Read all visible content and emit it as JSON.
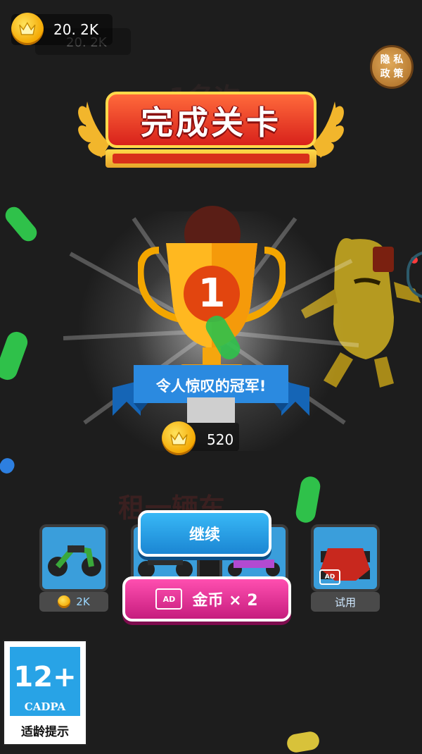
{
  "hud": {
    "coins": "20. 2K",
    "coins_ghost": "20. 2K",
    "privacy_label_1": "隐 私",
    "privacy_label_2": "政 策"
  },
  "result": {
    "title": "完成关卡",
    "rank": "1",
    "ribbon_text": "令人惊叹的冠军!",
    "reward": "520"
  },
  "background_text": {
    "top": "1名次",
    "mid": "租一辆车"
  },
  "vehicles": [
    {
      "name": "motorbike",
      "label": "2K",
      "has_coin": true
    },
    {
      "name": "atv",
      "label": "",
      "has_coin": false
    },
    {
      "name": "kart",
      "label": "",
      "has_coin": false
    },
    {
      "name": "racecar",
      "label": "试用",
      "has_coin": false,
      "ad": "AD"
    }
  ],
  "buttons": {
    "continue": "继续",
    "double_ad": "AD",
    "double": "金币  × 2"
  },
  "age_rating": {
    "number": "12+",
    "org": "CADPA",
    "tip": "适龄提示"
  },
  "colors": {
    "background": "#1d1d1d",
    "continue_button": "#2aa3e8",
    "double_button": "#e03594",
    "title_red": "#e5391f",
    "gold": "#f3a600"
  }
}
